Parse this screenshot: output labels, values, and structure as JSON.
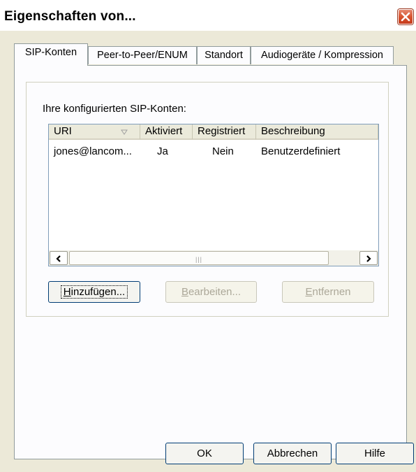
{
  "window": {
    "title": "Eigenschaften von..."
  },
  "tabs": [
    {
      "label": "SIP-Konten"
    },
    {
      "label": "Peer-to-Peer/ENUM"
    },
    {
      "label": "Standort"
    },
    {
      "label": "Audiogeräte / Kompression"
    }
  ],
  "accounts": {
    "group_label": "Ihre konfigurierten SIP-Konten:",
    "columns": [
      "URI",
      "Aktiviert",
      "Registriert",
      "Beschreibung"
    ],
    "rows": [
      {
        "uri": "jones@lancom...",
        "aktiviert": "Ja",
        "registriert": "Nein",
        "beschreibung": "Benutzerdefiniert"
      }
    ],
    "buttons": {
      "add": {
        "underline": "H",
        "rest": "inzufügen..."
      },
      "edit": {
        "underline": "B",
        "rest": "earbeiten..."
      },
      "remove": {
        "underline": "E",
        "rest": "ntfernen"
      }
    }
  },
  "footer": {
    "ok": "OK",
    "cancel": "Abbrechen",
    "help": "Hilfe"
  },
  "colors": {
    "accent": "#003c74",
    "close_button": "#d8542f"
  }
}
